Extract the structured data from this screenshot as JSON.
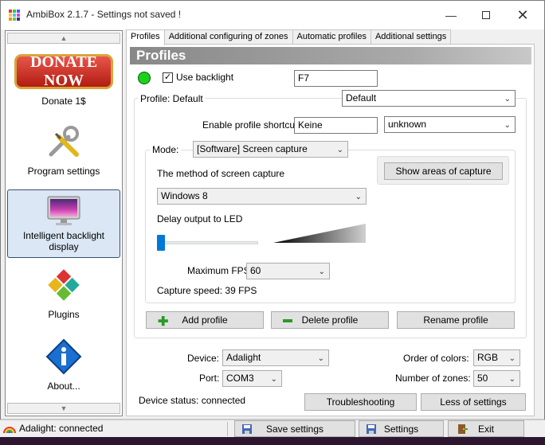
{
  "window": {
    "title": "AmbiBox 2.1.7  -  Settings not saved !"
  },
  "sidebar": {
    "donate_badge": "DONATE NOW",
    "items": [
      {
        "label": "Donate 1$"
      },
      {
        "label": "Program settings"
      },
      {
        "label": "Intelligent backlight display"
      },
      {
        "label": "Plugins"
      },
      {
        "label": "About..."
      }
    ]
  },
  "tabs": [
    "Profiles",
    "Additional configuring of zones",
    "Automatic profiles",
    "Additional settings"
  ],
  "profiles": {
    "header": "Profiles",
    "use_backlight_label": "Use backlight",
    "backlight_hotkey": "F7",
    "profile_label": "Profile: Default",
    "profile_select": "Default",
    "shortcut_label": "Enable profile shortcut:",
    "shortcut_value": "Keine",
    "shortcut_key": "unknown",
    "mode_label": "Mode:",
    "mode_value": "[Software] Screen capture",
    "capture_method_label": "The method of screen capture",
    "capture_method_value": "Windows 8",
    "show_areas_button": "Show areas of capture",
    "delay_label": "Delay output to LED",
    "delay_value": 0,
    "max_fps_label": "Maximum FPS",
    "max_fps_value": "60",
    "capture_speed": "Capture speed: 39 FPS",
    "add_profile": "Add profile",
    "delete_profile": "Delete profile",
    "rename_profile": "Rename profile"
  },
  "device": {
    "device_label": "Device:",
    "device_value": "Adalight",
    "port_label": "Port:",
    "port_value": "COM3",
    "order_label": "Order of colors:",
    "order_value": "RGB",
    "zones_label": "Number of zones:",
    "zones_value": "50",
    "status_text": "Device status: connected",
    "troubleshooting": "Troubleshooting",
    "less_settings": "Less of settings"
  },
  "statusbar": {
    "connection": "Adalight: connected",
    "save_settings": "Save settings",
    "settings": "Settings",
    "exit": "Exit"
  },
  "colors": {
    "accent": "#36506e",
    "led_on": "#1bd21b"
  }
}
